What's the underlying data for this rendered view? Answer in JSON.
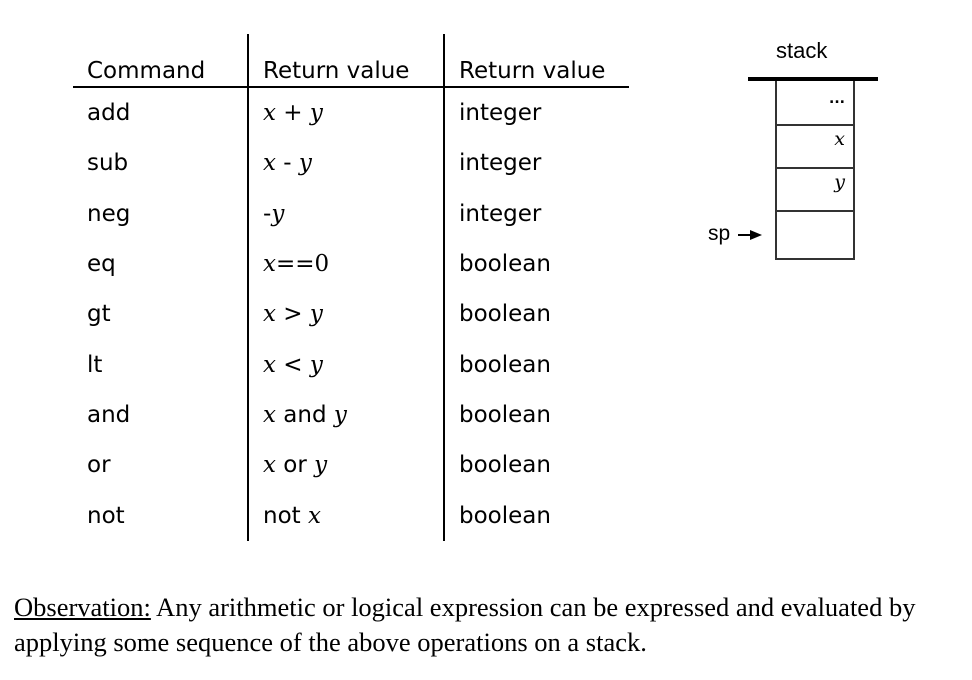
{
  "table": {
    "headers": [
      "Command",
      "Return value",
      "Return value"
    ],
    "rows": [
      {
        "command": "add",
        "ret": [
          {
            "t": "x",
            "s": "math"
          },
          {
            "t": " + ",
            "s": "math"
          },
          {
            "t": "y",
            "s": "math"
          }
        ],
        "type": "integer"
      },
      {
        "command": "sub",
        "ret": [
          {
            "t": "x",
            "s": "math"
          },
          {
            "t": " - ",
            "s": "mono"
          },
          {
            "t": "y",
            "s": "math"
          }
        ],
        "type": "integer"
      },
      {
        "command": "neg",
        "ret": [
          {
            "t": "-",
            "s": "mono"
          },
          {
            "t": "y",
            "s": "math"
          }
        ],
        "type": "integer"
      },
      {
        "command": "eq",
        "ret": [
          {
            "t": "x",
            "s": "math"
          },
          {
            "t": "==0",
            "s": "math-up"
          }
        ],
        "type": "boolean"
      },
      {
        "command": "gt",
        "ret": [
          {
            "t": "x",
            "s": "math"
          },
          {
            "t": " > ",
            "s": "mono"
          },
          {
            "t": "y",
            "s": "math"
          }
        ],
        "type": "boolean"
      },
      {
        "command": "lt",
        "ret": [
          {
            "t": "x",
            "s": "math"
          },
          {
            "t": " < ",
            "s": "mono"
          },
          {
            "t": "y",
            "s": "math"
          }
        ],
        "type": "boolean"
      },
      {
        "command": "and",
        "ret": [
          {
            "t": "x",
            "s": "math"
          },
          {
            "t": " and ",
            "s": "mono"
          },
          {
            "t": "y",
            "s": "math"
          }
        ],
        "type": "boolean"
      },
      {
        "command": "or",
        "ret": [
          {
            "t": "x",
            "s": "math"
          },
          {
            "t": " or ",
            "s": "mono"
          },
          {
            "t": "y",
            "s": "math"
          }
        ],
        "type": "boolean"
      },
      {
        "command": "not",
        "ret": [
          {
            "t": "not ",
            "s": "mono"
          },
          {
            "t": "x",
            "s": "math"
          }
        ],
        "type": "boolean"
      }
    ]
  },
  "stack": {
    "title": "stack",
    "cells": [
      "...",
      "x",
      "y",
      ""
    ],
    "pointer_label": "sp"
  },
  "observation": {
    "label": "Observation:",
    "text": " Any arithmetic or logical expression can be expressed and evaluated by applying some sequence of the above operations on a stack."
  }
}
